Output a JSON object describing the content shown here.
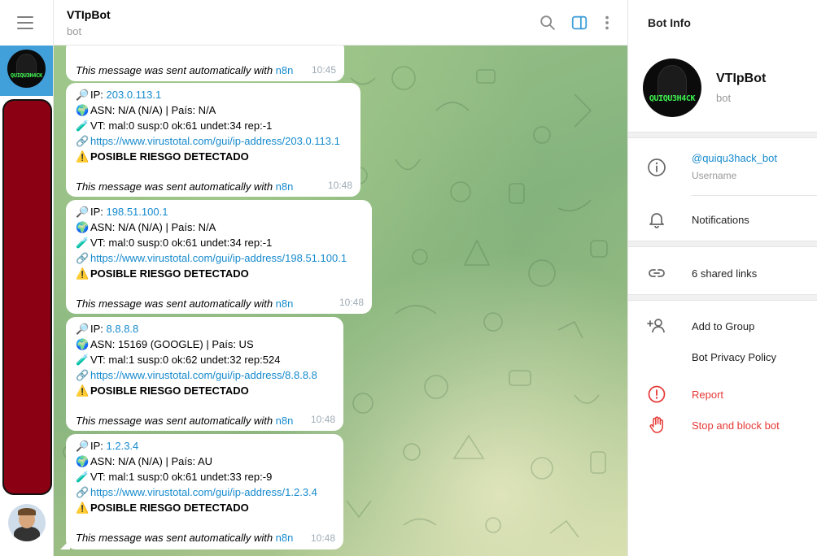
{
  "chat": {
    "title": "VTIpBot",
    "subtitle": "bot"
  },
  "avatar_label": "QUIQU3H4CK",
  "first_message": {
    "footer_text": "This message was sent automatically with ",
    "footer_link": "n8n",
    "time": "10:45"
  },
  "messages": [
    {
      "ip_label": "IP: ",
      "ip": "203.0.113.1",
      "asn": "ASN: N/A (N/A) | País: N/A",
      "vt": "VT: mal:0 susp:0 ok:61 undet:34 rep:-1",
      "url": "https://www.virustotal.com/gui/ip-address/203.0.113.1",
      "warning": "POSIBLE RIESGO DETECTADO",
      "footer_text": "This message was sent automatically with ",
      "footer_link": "n8n",
      "time": "10:48"
    },
    {
      "ip_label": "IP: ",
      "ip": "198.51.100.1",
      "asn": "ASN: N/A (N/A) | País: N/A",
      "vt": "VT: mal:0 susp:0 ok:61 undet:34 rep:-1",
      "url": "https://www.virustotal.com/gui/ip-address/198.51.100.1",
      "warning": "POSIBLE RIESGO DETECTADO",
      "footer_text": "This message was sent automatically with ",
      "footer_link": "n8n",
      "time": "10:48"
    },
    {
      "ip_label": "IP: ",
      "ip": "8.8.8.8",
      "asn": "ASN: 15169 (GOOGLE) | País: US",
      "vt": "VT: mal:1 susp:0 ok:62 undet:32 rep:524",
      "url": "https://www.virustotal.com/gui/ip-address/8.8.8.8",
      "warning": "POSIBLE RIESGO DETECTADO",
      "footer_text": "This message was sent automatically with ",
      "footer_link": "n8n",
      "time": "10:48"
    },
    {
      "ip_label": "IP: ",
      "ip": "1.2.3.4",
      "asn": "ASN: N/A (N/A) | País: AU",
      "vt": "VT: mal:1 susp:0 ok:61 undet:33 rep:-9",
      "url": "https://www.virustotal.com/gui/ip-address/1.2.3.4",
      "warning": "POSIBLE RIESGO DETECTADO",
      "footer_text": "This message was sent automatically with ",
      "footer_link": "n8n",
      "time": "10:48"
    }
  ],
  "emoji": {
    "ip": "🔎",
    "asn": "🌍",
    "vt": "🧪",
    "url": "🔗",
    "warning": "⚠️"
  },
  "side": {
    "title": "Bot Info",
    "name": "VTIpBot",
    "subtitle": "bot",
    "username": "@quiqu3hack_bot",
    "username_label": "Username",
    "notifications": "Notifications",
    "shared_links": "6 shared links",
    "add_to_group": "Add to Group",
    "privacy_policy": "Bot Privacy Policy",
    "report": "Report",
    "stop_block": "Stop and block bot"
  },
  "icons": {
    "menu": "hamburger-menu-icon",
    "search": "search-icon",
    "sidebar_toggle": "sidebar-toggle-icon",
    "more": "more-vertical-icon",
    "info": "info-icon",
    "bell": "bell-icon",
    "link": "link-icon",
    "add_user": "add-user-icon",
    "report": "report-icon",
    "stop": "hand-stop-icon"
  },
  "colors": {
    "accent": "#419fd9",
    "link": "#168acd",
    "danger": "#e53935",
    "time": "#a0acb6",
    "redacted": "#8b0012"
  }
}
